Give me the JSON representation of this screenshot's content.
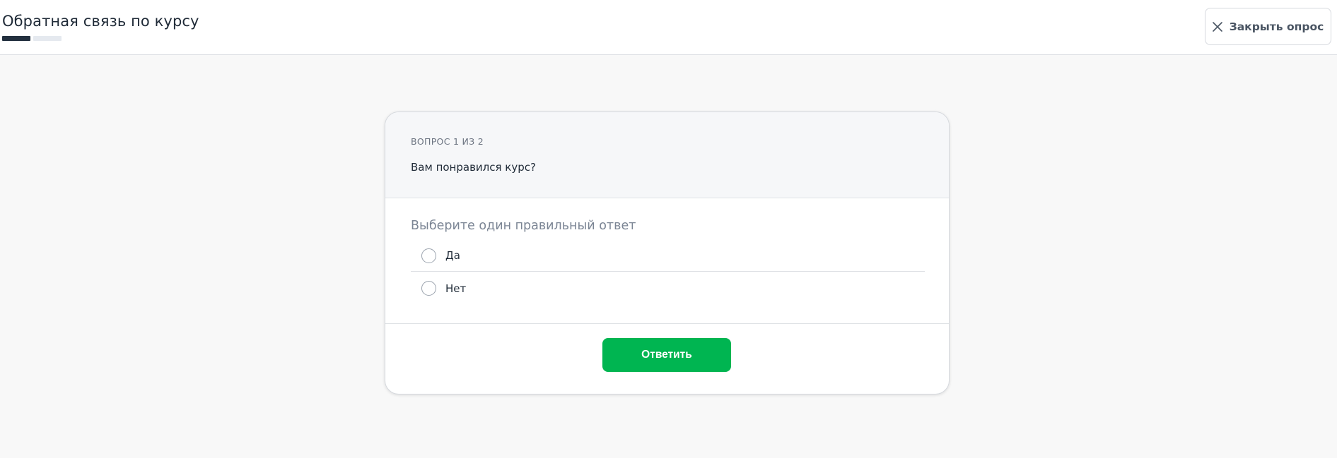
{
  "header": {
    "title": "Обратная связь по курсу",
    "progress": {
      "current": 1,
      "total": 2
    },
    "close_label": "Закрыть опрос",
    "close_icon": "close-icon"
  },
  "question": {
    "counter": "ВОПРОС 1 ИЗ 2",
    "text": "Вам понравился курс?",
    "instruction": "Выберите один правильный ответ",
    "options": [
      {
        "label": "Да",
        "selected": false
      },
      {
        "label": "Нет",
        "selected": false
      }
    ],
    "submit_label": "Ответить"
  },
  "colors": {
    "accent": "#00b551",
    "progress_done": "#23303f",
    "progress_todo": "#e5e9ef"
  }
}
